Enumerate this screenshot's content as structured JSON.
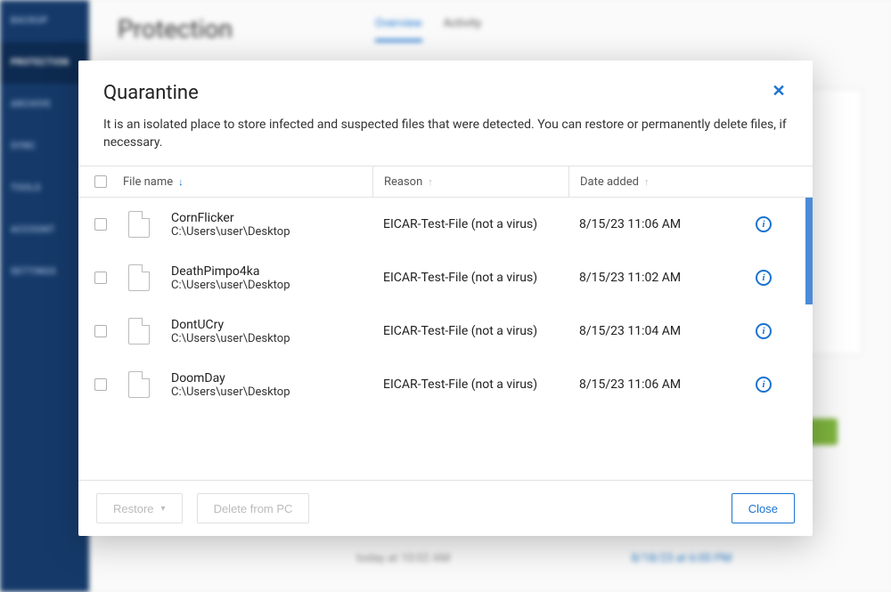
{
  "sidebar": {
    "items": [
      {
        "label": "BACKUP"
      },
      {
        "label": "PROTECTION"
      },
      {
        "label": "ARCHIVE"
      },
      {
        "label": "SYNC"
      },
      {
        "label": "TOOLS"
      },
      {
        "label": "ACCOUNT"
      },
      {
        "label": "SETTINGS"
      }
    ]
  },
  "page": {
    "title": "Protection",
    "tabs": [
      {
        "label": "Overview",
        "active": true
      },
      {
        "label": "Activity",
        "active": false
      }
    ],
    "bottom_time": "today at 10:02 AM",
    "bottom_link": "8/18/23 at 6:00 PM"
  },
  "modal": {
    "title": "Quarantine",
    "description": "It is an isolated place to store infected and suspected files that were detected. You can restore or permanently delete files, if necessary.",
    "columns": {
      "file": "File name",
      "reason": "Reason",
      "date": "Date added"
    },
    "rows": [
      {
        "name": "CornFlicker",
        "path": "C:\\Users\\user\\Desktop",
        "reason": "EICAR-Test-File (not a virus)",
        "date": "8/15/23 11:06 AM"
      },
      {
        "name": "DeathPimpo4ka",
        "path": "C:\\Users\\user\\Desktop",
        "reason": "EICAR-Test-File (not a virus)",
        "date": "8/15/23 11:02 AM"
      },
      {
        "name": "DontUCry",
        "path": "C:\\Users\\user\\Desktop",
        "reason": "EICAR-Test-File (not a virus)",
        "date": "8/15/23 11:04 AM"
      },
      {
        "name": "DoomDay",
        "path": "C:\\Users\\user\\Desktop",
        "reason": "EICAR-Test-File (not a virus)",
        "date": "8/15/23 11:06 AM"
      }
    ],
    "buttons": {
      "restore": "Restore",
      "delete": "Delete from PC",
      "close": "Close"
    }
  }
}
